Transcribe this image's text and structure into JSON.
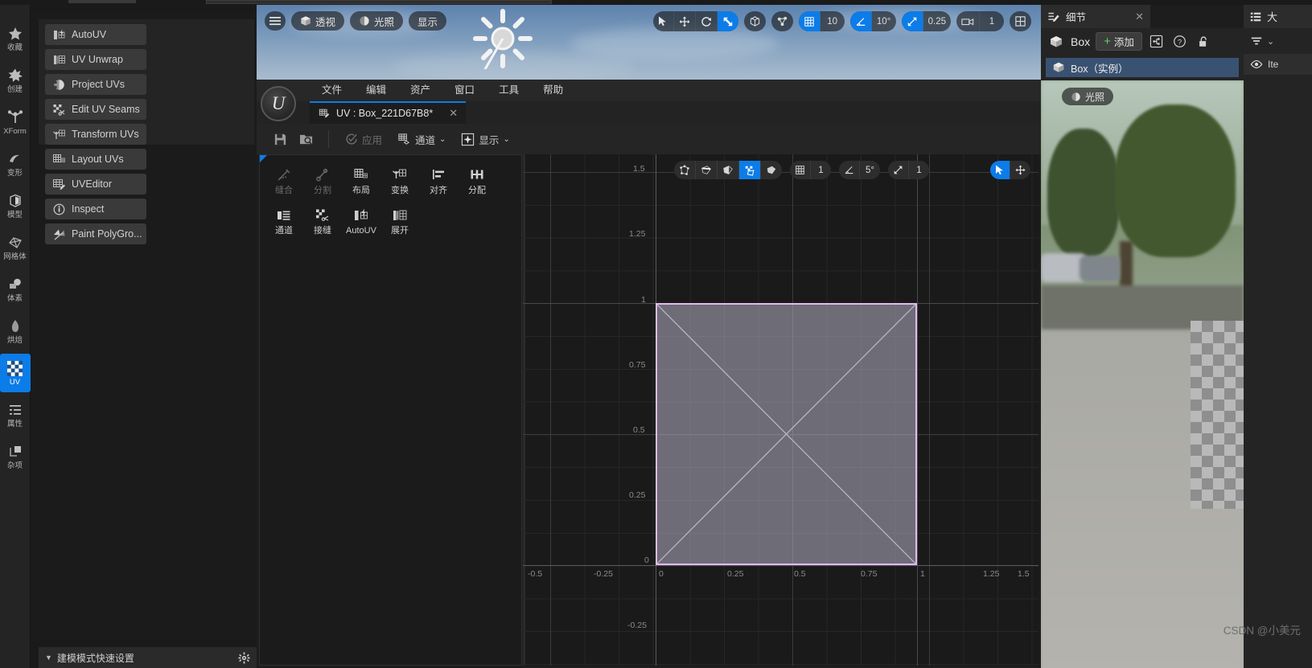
{
  "rail": {
    "items": [
      {
        "label": "收藏",
        "icon": "star-icon",
        "active": false
      },
      {
        "label": "创建",
        "icon": "create-star-icon",
        "active": false
      },
      {
        "label": "XForm",
        "icon": "axis-icon",
        "active": false
      },
      {
        "label": "变形",
        "icon": "deform-icon",
        "active": false
      },
      {
        "label": "模型",
        "icon": "model-cube-icon",
        "active": false
      },
      {
        "label": "网格体",
        "icon": "mesh-icon",
        "active": false
      },
      {
        "label": "体素",
        "icon": "voxel-icon",
        "active": false
      },
      {
        "label": "烘焙",
        "icon": "bake-flame-icon",
        "active": false
      },
      {
        "label": "UV",
        "icon": "uv-checker-icon",
        "active": true
      },
      {
        "label": "属性",
        "icon": "attributes-list-icon",
        "active": false
      },
      {
        "label": "杂项",
        "icon": "misc-icon",
        "active": false
      }
    ]
  },
  "palette": {
    "buttons": [
      {
        "label": "AutoUV",
        "icon": "autouv-icon"
      },
      {
        "label": "UV Unwrap",
        "icon": "uv-unwrap-icon"
      },
      {
        "label": "Project UVs",
        "icon": "project-uvs-icon"
      },
      {
        "label": "Edit UV Seams",
        "icon": "edit-uv-seams-icon"
      },
      {
        "label": "Transform UVs",
        "icon": "transform-uvs-icon"
      },
      {
        "label": "Layout UVs",
        "icon": "layout-uvs-icon"
      },
      {
        "label": "UVEditor",
        "icon": "uv-editor-icon"
      },
      {
        "label": "Inspect",
        "icon": "inspect-info-icon"
      },
      {
        "label": "Paint PolyGro...",
        "icon": "paint-polygroups-icon"
      }
    ]
  },
  "quick_settings": {
    "label": "建模模式快速设置",
    "gear_icon": "gear-icon",
    "chevron": "▼"
  },
  "viewport3d": {
    "menu_icon": "hamburger-icon",
    "perspective": {
      "label": "透视",
      "icon": "cube-icon"
    },
    "lighting": {
      "label": "光照",
      "icon": "lit-sphere-icon"
    },
    "show": {
      "label": "显示"
    },
    "transform_tools": [
      {
        "name": "select-tool",
        "icon": "cursor-arrow-icon",
        "on": false
      },
      {
        "name": "move-tool",
        "icon": "move-arrows-icon",
        "on": false
      },
      {
        "name": "rotate-tool",
        "icon": "rotate-icon",
        "on": false
      },
      {
        "name": "scale-tool",
        "icon": "scale-icon",
        "on": true
      }
    ],
    "coordinate_icon": "world-coords-icon",
    "pivot_icon": "pivot-icon",
    "grid_snap": {
      "icon": "grid-snap-icon",
      "value": "10",
      "on": true
    },
    "angle_snap": {
      "icon": "angle-snap-icon",
      "value": "10°",
      "on": true
    },
    "scale_snap": {
      "icon": "scale-snap-icon",
      "value": "0.25",
      "on": true
    },
    "camera_speed": {
      "icon": "camera-icon",
      "value": "1"
    },
    "layout_icon": "viewport-layout-icon"
  },
  "uv_window": {
    "logo": "unreal-engine-logo",
    "menus": [
      "文件",
      "编辑",
      "资产",
      "窗口",
      "工具",
      "帮助"
    ],
    "tab": {
      "label": "UV : Box_221D67B8*",
      "icon": "uv-editor-icon",
      "close": "✕"
    },
    "toolbar": {
      "save_icon": "save-icon",
      "browse_icon": "browse-content-icon",
      "apply": {
        "label": "应用",
        "icon": "apply-check-icon",
        "disabled": true
      },
      "channel": {
        "label": "通道",
        "icon": "channel-grid-icon",
        "chevron": "⌄"
      },
      "display": {
        "label": "显示",
        "icon": "display-star-icon",
        "chevron": "⌄"
      }
    },
    "tools": [
      {
        "label": "缝合",
        "icon": "sew-needle-icon",
        "disabled": true
      },
      {
        "label": "分割",
        "icon": "split-scissors-icon",
        "disabled": true
      },
      {
        "label": "布局",
        "icon": "layout-grid-icon",
        "disabled": false
      },
      {
        "label": "变换",
        "icon": "transform-axis-icon",
        "disabled": false
      },
      {
        "label": "对齐",
        "icon": "align-icon",
        "disabled": false
      },
      {
        "label": "分配",
        "icon": "distribute-icon",
        "disabled": false
      },
      {
        "label": "通道",
        "icon": "channel-layers-icon",
        "disabled": false
      },
      {
        "label": "接缝",
        "icon": "seams-scissors-icon",
        "disabled": false
      },
      {
        "label": "AutoUV",
        "icon": "autouv-icon",
        "disabled": false
      },
      {
        "label": "展开",
        "icon": "unwrap-icon",
        "disabled": false
      }
    ]
  },
  "uv_canvas": {
    "selection_modes": [
      {
        "name": "vertex-select-mode",
        "icon": "vertex-icon",
        "on": false
      },
      {
        "name": "edge-select-mode",
        "icon": "edge-icon",
        "on": false
      },
      {
        "name": "face-select-mode",
        "icon": "face-icon",
        "on": false
      },
      {
        "name": "island-select-mode",
        "icon": "island-icon",
        "on": true
      },
      {
        "name": "mesh-select-mode",
        "icon": "mesh-solid-icon",
        "on": false
      }
    ],
    "grid_snap": {
      "icon": "grid-snap-icon",
      "value": "1"
    },
    "angle_snap": {
      "icon": "angle-snap-icon",
      "value": "5°"
    },
    "scale_snap": {
      "icon": "scale-snap-icon",
      "value": "1"
    },
    "gizmo_tools": [
      {
        "name": "uv-select-tool",
        "icon": "cursor-arrow-icon",
        "on": true
      },
      {
        "name": "uv-move-tool",
        "icon": "move-arrows-icon",
        "on": false
      }
    ],
    "x_axis_labels": [
      "-0.5",
      "-0.25",
      "0",
      "0.25",
      "0.5",
      "0.75",
      "1",
      "1.25",
      "1.5"
    ],
    "y_axis_labels": [
      "1.5",
      "1.25",
      "1",
      "0.75",
      "0.5",
      "0.25",
      "0",
      "-0.25"
    ],
    "island": {
      "u_min": 0,
      "u_max": 1,
      "v_min": 0,
      "v_max": 1,
      "selected": true
    }
  },
  "details": {
    "tab": {
      "label": "细节",
      "icon": "details-pencil-icon",
      "close": "✕"
    },
    "object_name": "Box",
    "object_icon": "cube-icon",
    "add_button": {
      "label": "添加",
      "plus": "+"
    },
    "icons": [
      {
        "name": "blueprint-icon"
      },
      {
        "name": "help-question-icon"
      },
      {
        "name": "unlock-icon"
      }
    ],
    "row": {
      "label": "Box（实例）",
      "icon": "cube-icon",
      "selected": true
    },
    "preview_badge": {
      "label": "光照",
      "icon": "lit-sphere-icon"
    }
  },
  "outliner": {
    "tab": {
      "label": "大",
      "icon": "outliner-list-icon"
    },
    "filter_icon": "filter-icon",
    "filter_chevron": "⌄",
    "column": {
      "eye_icon": "eye-icon",
      "label": "Ite"
    }
  },
  "watermark": "CSDN @小美元",
  "colors": {
    "accent": "#0c7ce8",
    "panel_bg": "#242424",
    "canvas_bg": "#1a1a1a",
    "island_fill": "#b2b0c4",
    "island_border": "#e2b9ee",
    "row_selected": "#3a5272",
    "add_plus": "#5bd45b"
  }
}
